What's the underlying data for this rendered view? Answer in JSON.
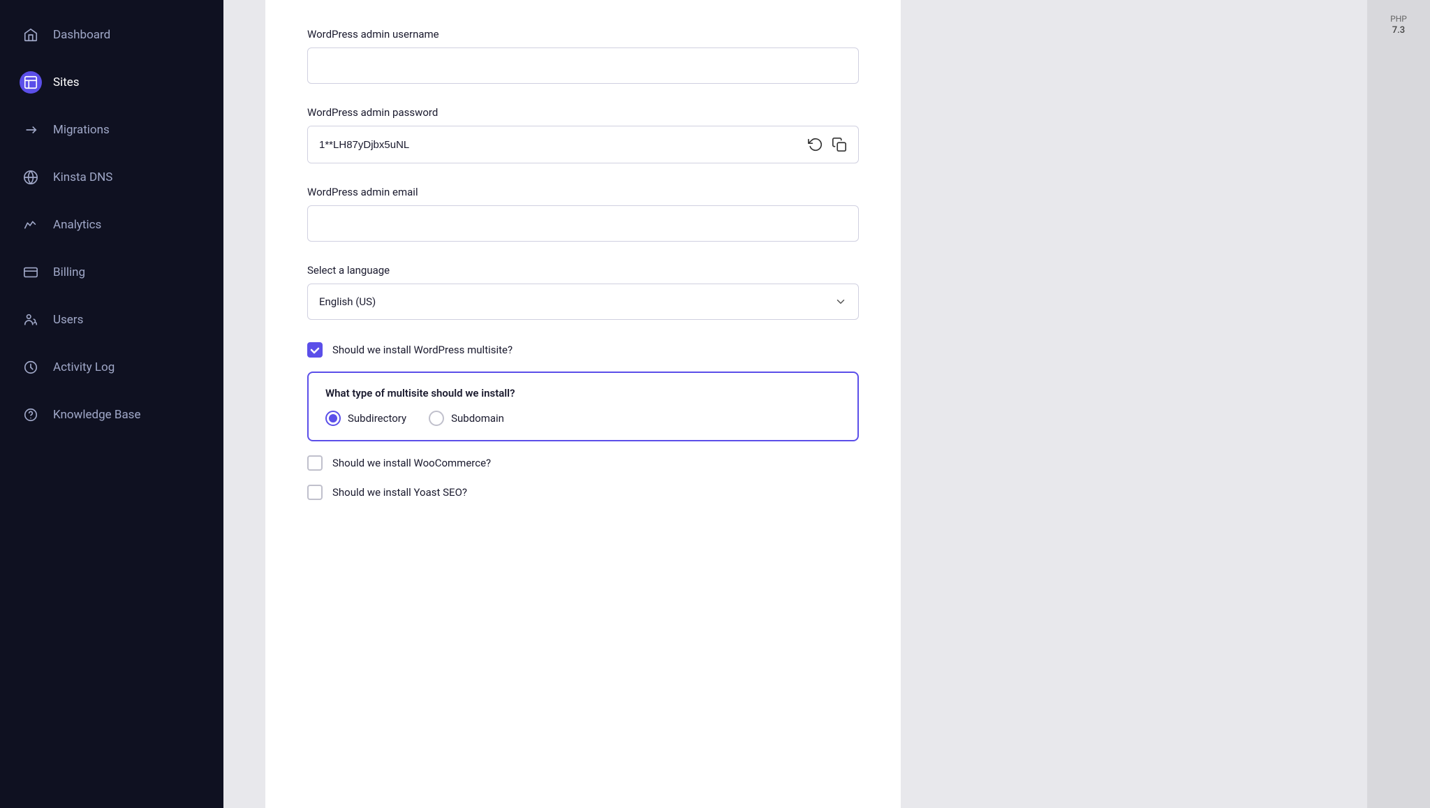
{
  "sidebar": {
    "items": [
      {
        "id": "dashboard",
        "label": "Dashboard",
        "icon": "home",
        "active": false
      },
      {
        "id": "sites",
        "label": "Sites",
        "icon": "sites",
        "active": true
      },
      {
        "id": "migrations",
        "label": "Migrations",
        "icon": "migrations",
        "active": false
      },
      {
        "id": "kinsta-dns",
        "label": "Kinsta DNS",
        "icon": "dns",
        "active": false
      },
      {
        "id": "analytics",
        "label": "Analytics",
        "icon": "analytics",
        "active": false
      },
      {
        "id": "billing",
        "label": "Billing",
        "icon": "billing",
        "active": false
      },
      {
        "id": "users",
        "label": "Users",
        "icon": "users",
        "active": false
      },
      {
        "id": "activity-log",
        "label": "Activity Log",
        "icon": "activity",
        "active": false
      },
      {
        "id": "knowledge-base",
        "label": "Knowledge Base",
        "icon": "help",
        "active": false
      }
    ]
  },
  "form": {
    "wp_admin_username_label": "WordPress admin username",
    "wp_admin_username_value": "",
    "wp_admin_username_placeholder": "",
    "wp_admin_password_label": "WordPress admin password",
    "wp_admin_password_value": "1**LH87yDjbx5uNL",
    "wp_admin_email_label": "WordPress admin email",
    "wp_admin_email_value": "",
    "wp_admin_email_placeholder": "",
    "select_language_label": "Select a language",
    "select_language_value": "English (US)",
    "multisite_checkbox_label": "Should we install WordPress multisite?",
    "multisite_checked": true,
    "multisite_type_question": "What type of multisite should we install?",
    "multisite_option1": "Subdirectory",
    "multisite_option2": "Subdomain",
    "woocommerce_checkbox_label": "Should we install WooCommerce?",
    "woocommerce_checked": false,
    "yoast_checkbox_label": "Should we install Yoast SEO?",
    "yoast_checked": false
  },
  "right_panel": {
    "php_label": "PHP",
    "php_version": "7.3"
  }
}
